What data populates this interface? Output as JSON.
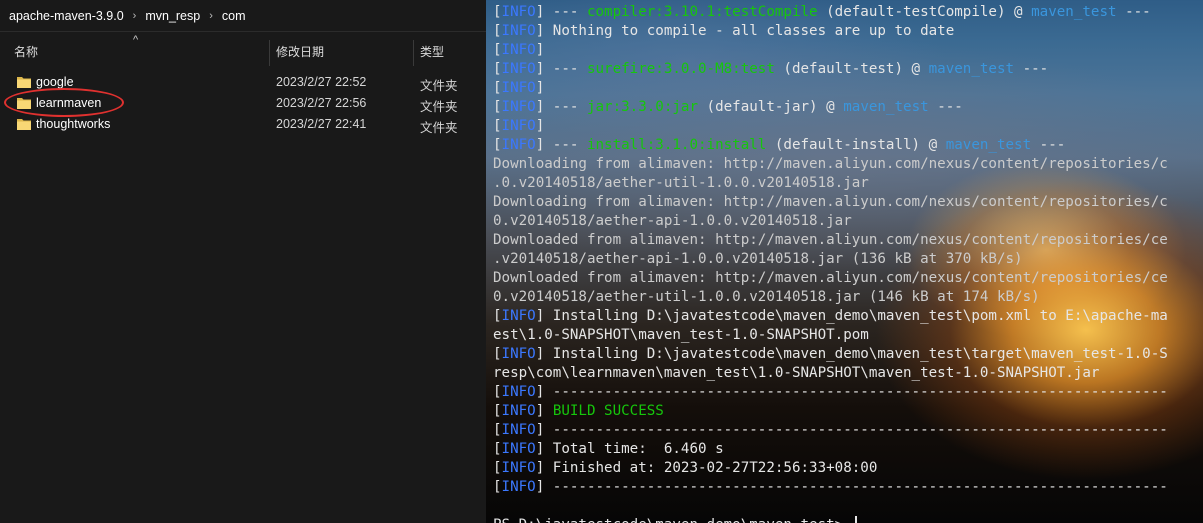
{
  "explorer": {
    "breadcrumb": [
      "apache-maven-3.9.0",
      "mvn_resp",
      "com"
    ],
    "breadcrumb_separator": "›",
    "columns": {
      "name": "名称",
      "date": "修改日期",
      "type": "类型"
    },
    "sort_indicator": "^",
    "rows": [
      {
        "name": "google",
        "date": "2023/2/27 22:52",
        "type": "文件夹"
      },
      {
        "name": "learnmaven",
        "date": "2023/2/27 22:56",
        "type": "文件夹"
      },
      {
        "name": "thoughtworks",
        "date": "2023/2/27 22:41",
        "type": "文件夹"
      }
    ],
    "folder_color": "#f8d775",
    "highlight_color": "#e0312f"
  },
  "terminal": {
    "lines": [
      [
        {
          "t": "[",
          "c": "bright"
        },
        {
          "t": "INFO",
          "c": "blue"
        },
        {
          "t": "] --- ",
          "c": "bright"
        },
        {
          "t": "compiler:3.10.1:testCompile",
          "c": "green"
        },
        {
          "t": " (default-testCompile) @ ",
          "c": "bright"
        },
        {
          "t": "maven_test",
          "c": "cyan"
        },
        {
          "t": " ---",
          "c": "bright"
        }
      ],
      [
        {
          "t": "[",
          "c": "bright"
        },
        {
          "t": "INFO",
          "c": "blue"
        },
        {
          "t": "] Nothing to compile - all classes are up to date",
          "c": "bright"
        }
      ],
      [
        {
          "t": "[",
          "c": "bright"
        },
        {
          "t": "INFO",
          "c": "blue"
        },
        {
          "t": "]",
          "c": "bright"
        }
      ],
      [
        {
          "t": "[",
          "c": "bright"
        },
        {
          "t": "INFO",
          "c": "blue"
        },
        {
          "t": "] --- ",
          "c": "bright"
        },
        {
          "t": "surefire:3.0.0-M8:test",
          "c": "green"
        },
        {
          "t": " (default-test) @ ",
          "c": "bright"
        },
        {
          "t": "maven_test",
          "c": "cyan"
        },
        {
          "t": " ---",
          "c": "bright"
        }
      ],
      [
        {
          "t": "[",
          "c": "bright"
        },
        {
          "t": "INFO",
          "c": "blue"
        },
        {
          "t": "]",
          "c": "bright"
        }
      ],
      [
        {
          "t": "[",
          "c": "bright"
        },
        {
          "t": "INFO",
          "c": "blue"
        },
        {
          "t": "] --- ",
          "c": "bright"
        },
        {
          "t": "jar:3.3.0:jar",
          "c": "green"
        },
        {
          "t": " (default-jar) @ ",
          "c": "bright"
        },
        {
          "t": "maven_test",
          "c": "cyan"
        },
        {
          "t": " ---",
          "c": "bright"
        }
      ],
      [
        {
          "t": "[",
          "c": "bright"
        },
        {
          "t": "INFO",
          "c": "blue"
        },
        {
          "t": "]",
          "c": "bright"
        }
      ],
      [
        {
          "t": "[",
          "c": "bright"
        },
        {
          "t": "INFO",
          "c": "blue"
        },
        {
          "t": "] --- ",
          "c": "bright"
        },
        {
          "t": "install:3.1.0:install",
          "c": "green"
        },
        {
          "t": " (default-install) @ ",
          "c": "bright"
        },
        {
          "t": "maven_test",
          "c": "cyan"
        },
        {
          "t": " ---",
          "c": "bright"
        }
      ],
      [
        {
          "t": "Downloading from alimaven: http://maven.aliyun.com/nexus/content/repositories/c",
          "c": "white"
        }
      ],
      [
        {
          "t": ".0.v20140518/aether-util-1.0.0.v20140518.jar",
          "c": "white"
        }
      ],
      [
        {
          "t": "Downloading from alimaven: http://maven.aliyun.com/nexus/content/repositories/c",
          "c": "white"
        }
      ],
      [
        {
          "t": "0.v20140518/aether-api-1.0.0.v20140518.jar",
          "c": "white"
        }
      ],
      [
        {
          "t": "Downloaded from alimaven: http://maven.aliyun.com/nexus/content/repositories/ce",
          "c": "white"
        }
      ],
      [
        {
          "t": ".v20140518/aether-api-1.0.0.v20140518.jar (136 kB at 370 kB/s)",
          "c": "white"
        }
      ],
      [
        {
          "t": "Downloaded from alimaven: http://maven.aliyun.com/nexus/content/repositories/ce",
          "c": "white"
        }
      ],
      [
        {
          "t": "0.v20140518/aether-util-1.0.0.v20140518.jar (146 kB at 174 kB/s)",
          "c": "white"
        }
      ],
      [
        {
          "t": "[",
          "c": "bright"
        },
        {
          "t": "INFO",
          "c": "blue"
        },
        {
          "t": "] Installing D:\\javatestcode\\maven_demo\\maven_test\\pom.xml to E:\\apache-ma",
          "c": "bright"
        }
      ],
      [
        {
          "t": "est\\1.0-SNAPSHOT\\maven_test-1.0-SNAPSHOT.pom",
          "c": "bright"
        }
      ],
      [
        {
          "t": "[",
          "c": "bright"
        },
        {
          "t": "INFO",
          "c": "blue"
        },
        {
          "t": "] Installing D:\\javatestcode\\maven_demo\\maven_test\\target\\maven_test-1.0-S",
          "c": "bright"
        }
      ],
      [
        {
          "t": "resp\\com\\learnmaven\\maven_test\\1.0-SNAPSHOT\\maven_test-1.0-SNAPSHOT.jar",
          "c": "bright"
        }
      ],
      [
        {
          "t": "[",
          "c": "bright"
        },
        {
          "t": "INFO",
          "c": "blue"
        },
        {
          "t": "] ------------------------------------------------------------------------",
          "c": "bright"
        }
      ],
      [
        {
          "t": "[",
          "c": "bright"
        },
        {
          "t": "INFO",
          "c": "blue"
        },
        {
          "t": "] ",
          "c": "bright"
        },
        {
          "t": "BUILD SUCCESS",
          "c": "green"
        }
      ],
      [
        {
          "t": "[",
          "c": "bright"
        },
        {
          "t": "INFO",
          "c": "blue"
        },
        {
          "t": "] ------------------------------------------------------------------------",
          "c": "bright"
        }
      ],
      [
        {
          "t": "[",
          "c": "bright"
        },
        {
          "t": "INFO",
          "c": "blue"
        },
        {
          "t": "] Total time:  6.460 s",
          "c": "bright"
        }
      ],
      [
        {
          "t": "[",
          "c": "bright"
        },
        {
          "t": "INFO",
          "c": "blue"
        },
        {
          "t": "] Finished at: 2023-02-27T22:56:33+08:00",
          "c": "bright"
        }
      ],
      [
        {
          "t": "[",
          "c": "bright"
        },
        {
          "t": "INFO",
          "c": "blue"
        },
        {
          "t": "] ------------------------------------------------------------------------",
          "c": "bright"
        }
      ],
      [
        {
          "t": "",
          "c": "white"
        }
      ],
      [
        {
          "t": "PS D:\\javatestcode\\maven_demo\\maven_test> ",
          "c": "bright"
        }
      ]
    ]
  }
}
